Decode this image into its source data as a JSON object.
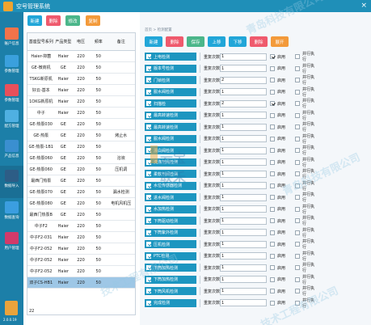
{
  "app": {
    "title": "空号管理系统"
  },
  "sidebar": {
    "items": [
      {
        "label": "账户信息",
        "color": "#f2734a"
      },
      {
        "label": "参数管理",
        "color": "#3aa0dd"
      },
      {
        "label": "参数管理",
        "color": "#e8505b"
      },
      {
        "label": "配方管理",
        "color": "#4fb0e2"
      },
      {
        "label": "产品信息",
        "color": "#3a8fd0"
      },
      {
        "label": "数据导入",
        "color": "#2d5d86"
      },
      {
        "label": "数据查询",
        "color": "#3b9ee0"
      },
      {
        "label": "用户管理",
        "color": "#d23a6a"
      }
    ],
    "version": "2.0.0.19"
  },
  "left": {
    "buttons": [
      {
        "label": "新建",
        "color": "#21a6d8"
      },
      {
        "label": "删除",
        "color": "#ef5a6d"
      },
      {
        "label": "修改",
        "color": "#4bb68a"
      },
      {
        "label": "复制",
        "color": "#f39a3a"
      }
    ],
    "headers": [
      "基座型号系列",
      "产品类型",
      "电压",
      "频率",
      "备注"
    ],
    "rows": [
      [
        "Haier-抑菌",
        "Haier",
        "220",
        "50",
        ""
      ],
      [
        "GE-微商机",
        "GE",
        "220",
        "50",
        ""
      ],
      [
        "TSKG新原机",
        "Haier",
        "220",
        "50",
        ""
      ],
      [
        "好云-基本",
        "Haier",
        "220",
        "50",
        ""
      ],
      [
        "1OKG新原机",
        "Haier",
        "220",
        "50",
        ""
      ],
      [
        "中子",
        "Haier",
        "220",
        "50",
        ""
      ],
      [
        "GE-热泵030",
        "GE",
        "220",
        "50",
        ""
      ],
      [
        "GE-热泵",
        "GE",
        "220",
        "50",
        "烤止水"
      ],
      [
        "GE-热泵-1B1",
        "GE",
        "220",
        "50",
        ""
      ],
      [
        "GE-热泵060",
        "GE",
        "220",
        "50",
        "溶液"
      ],
      [
        "GE-热泵060",
        "GE",
        "220",
        "50",
        "压机调"
      ],
      [
        "最西门热泵",
        "GE",
        "220",
        "50",
        ""
      ],
      [
        "GE-热泵070",
        "GE",
        "220",
        "50",
        "漏水检测"
      ],
      [
        "GE-热泵080",
        "GE",
        "220",
        "50",
        "电机风机压"
      ],
      [
        "最西门热泵B",
        "GE",
        "220",
        "50",
        ""
      ],
      [
        "中子F2",
        "Haier",
        "220",
        "50",
        ""
      ],
      [
        "中子F2-031",
        "Haier",
        "220",
        "50",
        ""
      ],
      [
        "中子F2-052",
        "Haier",
        "220",
        "50",
        ""
      ],
      [
        "中子F2-052",
        "Haier",
        "220",
        "50",
        ""
      ],
      [
        "中子F2-052",
        "Haier",
        "220",
        "50",
        ""
      ],
      [
        "双子CS-HB1",
        "Haier",
        "220",
        "50",
        ""
      ]
    ],
    "selected_row": 20,
    "count": "22"
  },
  "right": {
    "breadcrumb": "首页 > 检测配置",
    "buttons": [
      {
        "label": "新建",
        "color": "#21a6d8"
      },
      {
        "label": "删除",
        "color": "#ef5a6d"
      },
      {
        "label": "保存",
        "color": "#4bb68a"
      },
      {
        "label": "上移",
        "color": "#21a6d8"
      },
      {
        "label": "下移",
        "color": "#21a6d8"
      },
      {
        "label": "删除",
        "color": "#ef5a6d"
      },
      {
        "label": "展开",
        "color": "#f39a3a"
      }
    ],
    "repeat_label": "重复次数",
    "enable_label": "启用",
    "parallel_label": "并行执行",
    "items": [
      {
        "name": "上电检测",
        "count": "1",
        "enable": true,
        "parallel": false
      },
      {
        "name": "版本号检测",
        "count": "1",
        "enable": false,
        "parallel": false
      },
      {
        "name": "门锁检测",
        "count": "2",
        "enable": false,
        "parallel": false
      },
      {
        "name": "脱水阀检测",
        "count": "1",
        "enable": false,
        "parallel": false
      },
      {
        "name": "扫描检",
        "count": "2",
        "enable": true,
        "parallel": false
      },
      {
        "name": "最高转速检测",
        "count": "1",
        "enable": false,
        "parallel": false
      },
      {
        "name": "最高转速检测",
        "count": "1",
        "enable": false,
        "parallel": false
      },
      {
        "name": "脱水阀检测",
        "count": "1",
        "enable": false,
        "parallel": false
      },
      {
        "name": "漂白阀检测",
        "count": "1",
        "enable": false,
        "parallel": false
      },
      {
        "name": "洗涤剂阀检测",
        "count": "1",
        "enable": false,
        "parallel": false
      },
      {
        "name": "柔软剂阀检测",
        "count": "1",
        "enable": false,
        "parallel": false
      },
      {
        "name": "水位传感器检测",
        "count": "1",
        "enable": false,
        "parallel": false
      },
      {
        "name": "进水阀检测",
        "count": "1",
        "enable": false,
        "parallel": false
      },
      {
        "name": "水加热检测",
        "count": "1",
        "enable": false,
        "parallel": false
      },
      {
        "name": "下筒驱动检测",
        "count": "1",
        "enable": false,
        "parallel": false
      },
      {
        "name": "下筒紫外检测",
        "count": "1",
        "enable": false,
        "parallel": false
      },
      {
        "name": "压机检测",
        "count": "1",
        "enable": false,
        "parallel": false
      },
      {
        "name": "PTC检测",
        "count": "1",
        "enable": false,
        "parallel": false
      },
      {
        "name": "下筒加热检测",
        "count": "1",
        "enable": false,
        "parallel": false
      },
      {
        "name": "下筒加热检测",
        "count": "1",
        "enable": false,
        "parallel": false
      },
      {
        "name": "下筒风机检测",
        "count": "1",
        "enable": false,
        "parallel": false
      },
      {
        "name": "完成检测",
        "count": "1",
        "enable": false,
        "parallel": false
      }
    ]
  },
  "watermark": {
    "texts": [
      "青岛科技有限公司",
      "青岛科技有限公司",
      "技术工程有限公司",
      "技术工程有限公司"
    ],
    "logo_text": "云宝联禾"
  }
}
